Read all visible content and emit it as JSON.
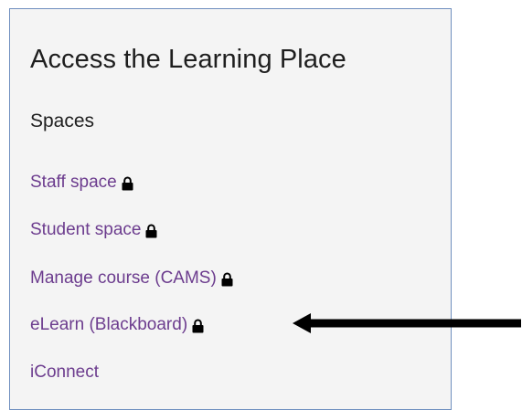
{
  "panel": {
    "title": "Access the Learning Place",
    "section_heading": "Spaces",
    "links": [
      {
        "label": "Staff space",
        "locked": true,
        "icon": "lock-icon"
      },
      {
        "label": "Student space",
        "locked": true,
        "icon": "lock-icon"
      },
      {
        "label": "Manage course (CAMS)",
        "locked": true,
        "icon": "lock-icon"
      },
      {
        "label": "eLearn (Blackboard)",
        "locked": true,
        "icon": "lock-icon"
      },
      {
        "label": "iConnect",
        "locked": false
      }
    ]
  },
  "annotation": {
    "icon": "arrow-left-icon",
    "color": "#000000"
  },
  "colors": {
    "link": "#6c3c8e",
    "panel_bg": "#f4f4f4",
    "panel_border": "#6f8fbf"
  }
}
